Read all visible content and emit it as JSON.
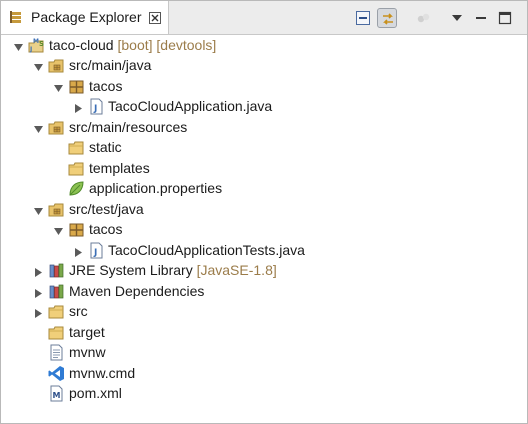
{
  "view": {
    "title": "Package Explorer",
    "icons": {
      "view": "package-explorer-icon",
      "close": "close-icon",
      "collapse_all": "collapse-all-icon",
      "link_with_editor": "link-with-editor-icon",
      "focus": "focus-on-task-icon",
      "view_menu": "view-menu-icon",
      "minimize": "minimize-icon",
      "maximize": "maximize-icon"
    }
  },
  "tree": [
    {
      "label": "taco-cloud",
      "decoration": "[boot] [devtools]",
      "icon": "spring-boot-project-icon",
      "expanded": true
    },
    {
      "label": "src/main/java",
      "icon": "source-folder-icon",
      "expanded": true
    },
    {
      "label": "tacos",
      "icon": "package-icon",
      "expanded": true
    },
    {
      "label": "TacoCloudApplication.java",
      "icon": "java-file-icon",
      "expanded": false
    },
    {
      "label": "src/main/resources",
      "icon": "source-folder-icon",
      "expanded": true
    },
    {
      "label": "static",
      "icon": "folder-icon"
    },
    {
      "label": "templates",
      "icon": "folder-icon"
    },
    {
      "label": "application.properties",
      "icon": "properties-file-icon"
    },
    {
      "label": "src/test/java",
      "icon": "source-folder-icon",
      "expanded": true
    },
    {
      "label": "tacos",
      "icon": "package-icon",
      "expanded": true
    },
    {
      "label": "TacoCloudApplicationTests.java",
      "icon": "java-file-icon",
      "expanded": false
    },
    {
      "label": "JRE System Library",
      "decoration": "[JavaSE-1.8]",
      "icon": "library-icon",
      "expanded": false
    },
    {
      "label": "Maven Dependencies",
      "icon": "library-icon",
      "expanded": false
    },
    {
      "label": "src",
      "icon": "folder-icon",
      "expanded": false
    },
    {
      "label": "target",
      "icon": "folder-icon"
    },
    {
      "label": "mvnw",
      "icon": "text-file-icon"
    },
    {
      "label": "mvnw.cmd",
      "icon": "cmd-file-icon"
    },
    {
      "label": "pom.xml",
      "icon": "maven-pom-icon"
    }
  ],
  "colors": {
    "decoration": "#9b7c4a",
    "folder": "#e8c36a",
    "package": "#c69a3c",
    "java": "#3b6fb6"
  }
}
